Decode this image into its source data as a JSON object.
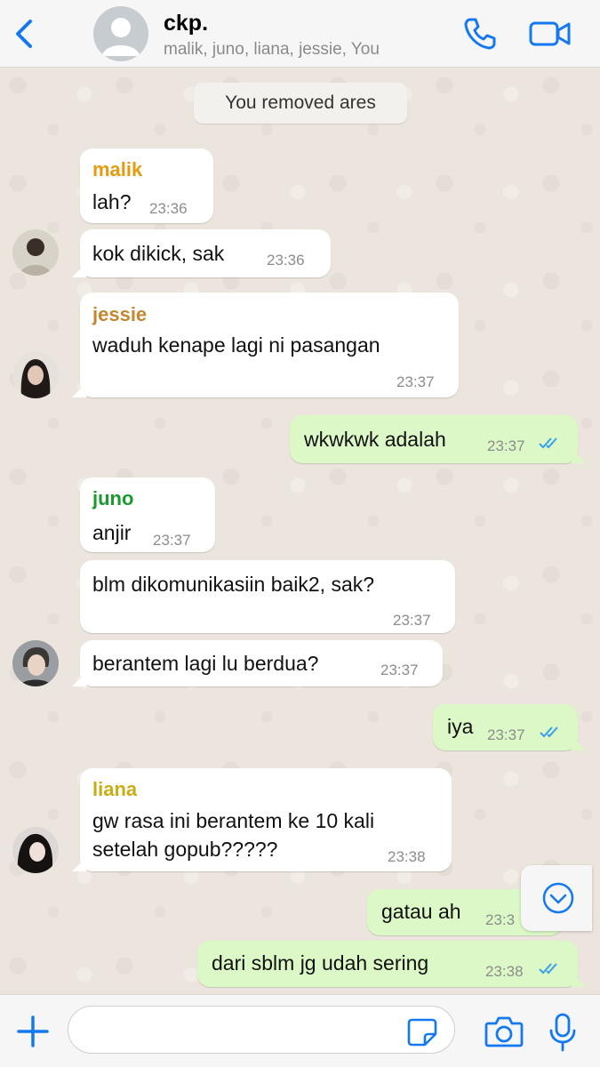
{
  "header": {
    "title": "ckp.",
    "subtitle": "malik, juno, liana, jessie, You"
  },
  "system_message": "You removed ares",
  "messages": [
    {
      "sender": "malik",
      "text": "lah?",
      "time": "23:36"
    },
    {
      "text": "kok dikick, sak",
      "time": "23:36"
    },
    {
      "sender": "jessie",
      "text": "waduh kenape lagi ni pasangan",
      "time": "23:37"
    },
    {
      "text": "wkwkwk adalah",
      "time": "23:37",
      "outgoing": true,
      "status": "read"
    },
    {
      "sender": "juno",
      "text": "anjir",
      "time": "23:37"
    },
    {
      "text": "blm dikomunikasiin baik2, sak?",
      "time": "23:37"
    },
    {
      "text": "berantem lagi lu berdua?",
      "time": "23:37"
    },
    {
      "text": "iya",
      "time": "23:37",
      "outgoing": true,
      "status": "read"
    },
    {
      "sender": "liana",
      "text_line1": "gw rasa ini berantem ke 10 kali",
      "text_line2": "setelah gopub?????",
      "time": "23:38"
    },
    {
      "text": "gatau ah",
      "time": "23:3",
      "outgoing": true
    },
    {
      "text": "dari sblm jg udah sering",
      "time": "23:38",
      "outgoing": true,
      "status": "read"
    }
  ],
  "colors": {
    "malik": "#e69a0f",
    "jessie": "#c4862f",
    "juno": "#1a9a2e",
    "liana": "#c9ad16",
    "accent": "#1479f0",
    "read_ticks": "#3aa0ec",
    "outgoing_bubble": "#dcf8c6",
    "incoming_bubble": "#ffffff"
  },
  "icons": {
    "back": "chevron-left-icon",
    "call": "phone-icon",
    "video": "video-camera-icon",
    "scroll": "chevron-down-circle-icon",
    "attach": "plus-icon",
    "sticker": "sticker-icon",
    "camera": "camera-icon",
    "mic": "microphone-icon"
  },
  "input": {
    "placeholder": ""
  }
}
